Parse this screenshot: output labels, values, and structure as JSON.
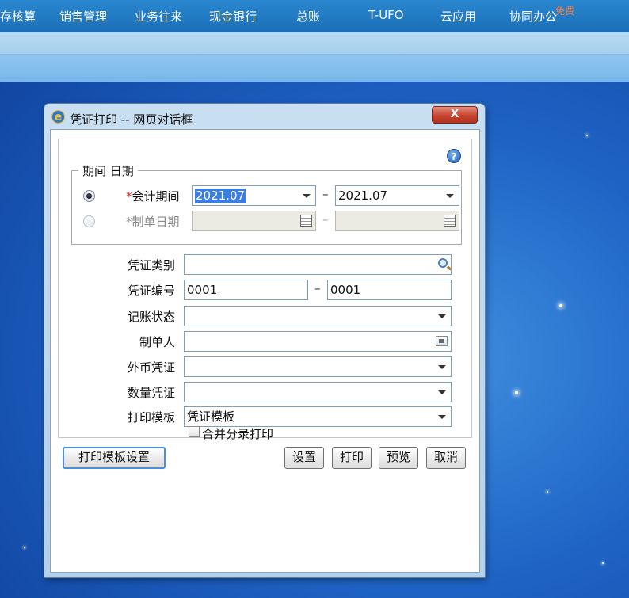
{
  "topnav": {
    "items": [
      "存核算",
      "销售管理",
      "业务往来",
      "现金银行",
      "总账",
      "T-UFO",
      "云应用",
      "协同办公"
    ],
    "badge": "免费"
  },
  "dialog": {
    "title": "凭证打印 -- 网页对话框",
    "close_label": "X",
    "help_label": "?",
    "group_legend": "期间 日期",
    "period": {
      "required_mark": "*",
      "label": "会计期间",
      "from": "2021.07",
      "separator": "–",
      "to": "2021.07"
    },
    "date": {
      "required_mark": "*",
      "label": "制单日期",
      "from": "",
      "separator": "–",
      "to": ""
    },
    "voucher_type": {
      "label": "凭证类别",
      "value": ""
    },
    "voucher_no": {
      "label": "凭证编号",
      "from": "0001",
      "separator": "–",
      "to": "0001"
    },
    "post_status": {
      "label": "记账状态",
      "value": ""
    },
    "preparer": {
      "label": "制单人",
      "value": ""
    },
    "fx_voucher": {
      "label": "外币凭证",
      "value": ""
    },
    "qty_voucher": {
      "label": "数量凭证",
      "value": ""
    },
    "print_template": {
      "label": "打印模板",
      "value": "凭证模板"
    },
    "merge_print": {
      "label": "合并分录打印",
      "checked": false
    },
    "buttons": {
      "template_settings": "打印模板设置",
      "settings": "设置",
      "print": "打印",
      "preview": "预览",
      "cancel": "取消"
    }
  }
}
